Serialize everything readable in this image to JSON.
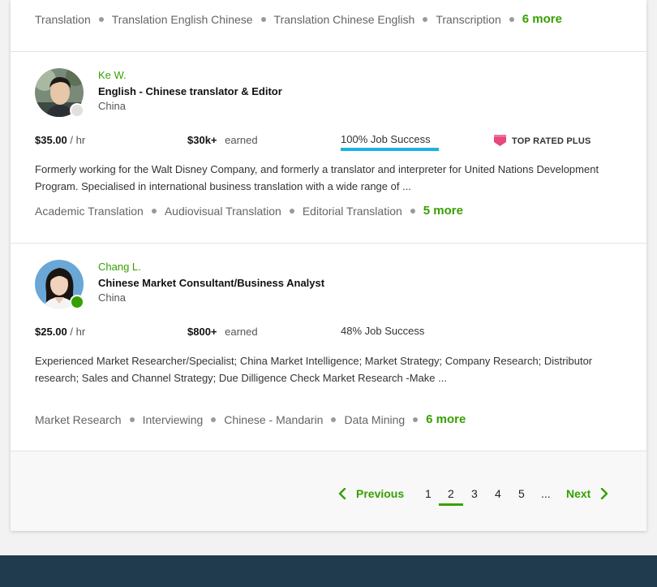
{
  "top_tags": {
    "items": [
      "Translation",
      "Translation English Chinese",
      "Translation Chinese English",
      "Transcription"
    ],
    "more": "6 more"
  },
  "freelancers": [
    {
      "name": "Ke W.",
      "title": "English - Chinese translator & Editor",
      "country": "China",
      "status": "offline",
      "rate": "$35.00",
      "rate_unit": "/ hr",
      "earned": "$30k+",
      "earned_label": "earned",
      "job_success": "100% Job Success",
      "job_success_fraction": 1.0,
      "badge": "TOP RATED PLUS",
      "description": "Formerly working for the Walt Disney Company, and formerly a translator and interpreter for United Nations Development Program. Specialised in international business translation with a wide range of ...",
      "skills": [
        "Academic Translation",
        "Audiovisual Translation",
        "Editorial Translation"
      ],
      "more": "5 more"
    },
    {
      "name": "Chang L.",
      "title": "Chinese Market Consultant/Business Analyst",
      "country": "China",
      "status": "online",
      "rate": "$25.00",
      "rate_unit": "/ hr",
      "earned": "$800+",
      "earned_label": "earned",
      "job_success": "48% Job Success",
      "description": "Experienced Market Researcher/Specialist; China Market Intelligence; Market Strategy; Company Research; Distributor research; Sales and Channel Strategy; Due Dilligence Check Market Research -Make ...",
      "skills": [
        "Market Research",
        "Interviewing",
        "Chinese - Mandarin",
        "Data Mining"
      ],
      "more": "6 more"
    }
  ],
  "pagination": {
    "previous": "Previous",
    "next": "Next",
    "pages": [
      "1",
      "2",
      "3",
      "4",
      "5"
    ],
    "ellipsis": "...",
    "current": "2"
  },
  "colors": {
    "accent": "#37a000",
    "job_success_bar": "#1db3e0",
    "badge": "#e5497f",
    "footer": "#1f3b4d",
    "online": "#37a000",
    "offline": "#e0e0e0"
  }
}
